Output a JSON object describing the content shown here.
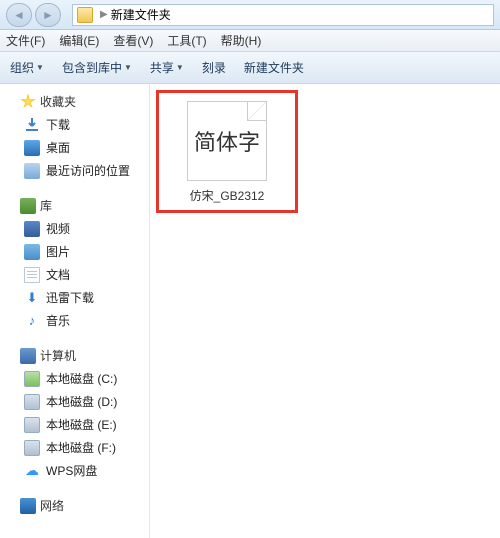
{
  "titlebar": {
    "folder_name": "新建文件夹"
  },
  "menubar": {
    "file": "文件(F)",
    "edit": "编辑(E)",
    "view": "查看(V)",
    "tools": "工具(T)",
    "help": "帮助(H)"
  },
  "toolbar": {
    "organize": "组织",
    "include": "包含到库中",
    "share": "共享",
    "burn": "刻录",
    "new_folder": "新建文件夹"
  },
  "sidebar": {
    "favorites": {
      "label": "收藏夹",
      "items": [
        {
          "label": "下载"
        },
        {
          "label": "桌面"
        },
        {
          "label": "最近访问的位置"
        }
      ]
    },
    "libraries": {
      "label": "库",
      "items": [
        {
          "label": "视频"
        },
        {
          "label": "图片"
        },
        {
          "label": "文档"
        },
        {
          "label": "迅雷下载"
        },
        {
          "label": "音乐"
        }
      ]
    },
    "computer": {
      "label": "计算机",
      "items": [
        {
          "label": "本地磁盘 (C:)"
        },
        {
          "label": "本地磁盘 (D:)"
        },
        {
          "label": "本地磁盘 (E:)"
        },
        {
          "label": "本地磁盘 (F:)"
        },
        {
          "label": "WPS网盘"
        }
      ]
    },
    "network": {
      "label": "网络"
    }
  },
  "content": {
    "file_thumb_text": "简体字",
    "file_name": "仿宋_GB2312"
  }
}
